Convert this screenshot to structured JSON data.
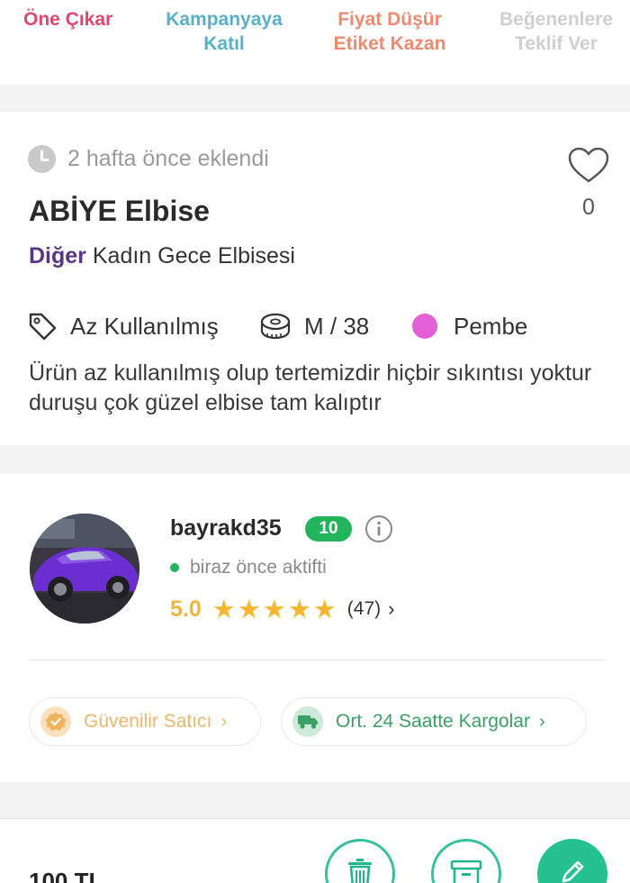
{
  "actions": {
    "feature": "Öne Çıkar",
    "campaign": "Kampanyaya\nKatıl",
    "price_drop": "Fiyat Düşür\nEtiket Kazan",
    "offer_likers": "Beğenenlere\nTeklif Ver"
  },
  "product": {
    "added_time": "2 hafta önce eklendi",
    "title": "ABİYE Elbise",
    "category_main": "Diğer",
    "category_sub": "Kadın Gece Elbisesi",
    "like_count": "0",
    "condition": "Az Kullanılmış",
    "size": "M / 38",
    "color_name": "Pembe",
    "color_hex": "#e35fd5",
    "description": "Ürün az kullanılmış olup tertemizdir hiçbir sıkıntısı yoktur duruşu çok güzel elbise tam kalıptır"
  },
  "seller": {
    "username": "bayrakd35",
    "level": "10",
    "status": "biraz önce aktifti",
    "rating": "5.0",
    "stars": "★★★★★",
    "review_count": "(47)",
    "badges": {
      "trusted": "Güvenilir Satıcı",
      "shipping": "Ort. 24 Saatte Kargolar"
    }
  },
  "footer": {
    "price": "100 TL"
  },
  "icons": {
    "clock": "clock-icon",
    "heart": "heart-icon",
    "tag": "tag-icon",
    "tape": "measuring-tape-icon",
    "info": "info-icon",
    "trusted": "badge-check-icon",
    "truck": "truck-icon",
    "trash": "trash-icon",
    "box": "box-icon",
    "edit": "pencil-icon"
  },
  "colors": {
    "brand_green": "#21b45d",
    "teal": "#25c28f",
    "star": "#f5b731",
    "category": "#5b3585"
  }
}
